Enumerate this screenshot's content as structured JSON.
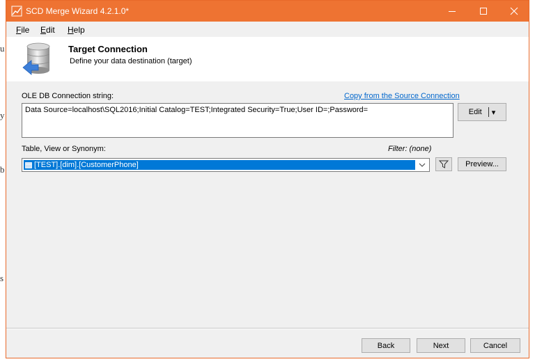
{
  "window": {
    "title": "SCD Merge Wizard 4.2.1.0*",
    "controls": {
      "minimize": "—",
      "maximize": "☐",
      "close": "✕"
    },
    "accent_color": "#ee7332"
  },
  "background_fragments": [
    "u",
    "y",
    "b",
    "s"
  ],
  "menu": {
    "file": {
      "key": "F",
      "rest": "ile"
    },
    "edit": {
      "key": "E",
      "rest": "dit"
    },
    "help": {
      "key": "H",
      "rest": "elp"
    }
  },
  "header": {
    "title": "Target Connection",
    "subtitle": "Define your data destination (target)",
    "icon": "database-target-icon"
  },
  "connection": {
    "label": "OLE DB Connection string:",
    "copy_link": "Copy from the Source Connection",
    "value": "Data Source=localhost\\SQL2016;Initial Catalog=TEST;Integrated Security=True;User ID=;Password=",
    "edit_button": "Edit",
    "edit_dropdown": "▾"
  },
  "table": {
    "label": "Table, View or Synonym:",
    "filter_label": "Filter: (none)",
    "selected": "[TEST].[dim].[CustomerPhone]",
    "selection_color": "#0078d7",
    "preview_button": "Preview..."
  },
  "footer": {
    "back": "Back",
    "next": "Next",
    "cancel": "Cancel"
  }
}
